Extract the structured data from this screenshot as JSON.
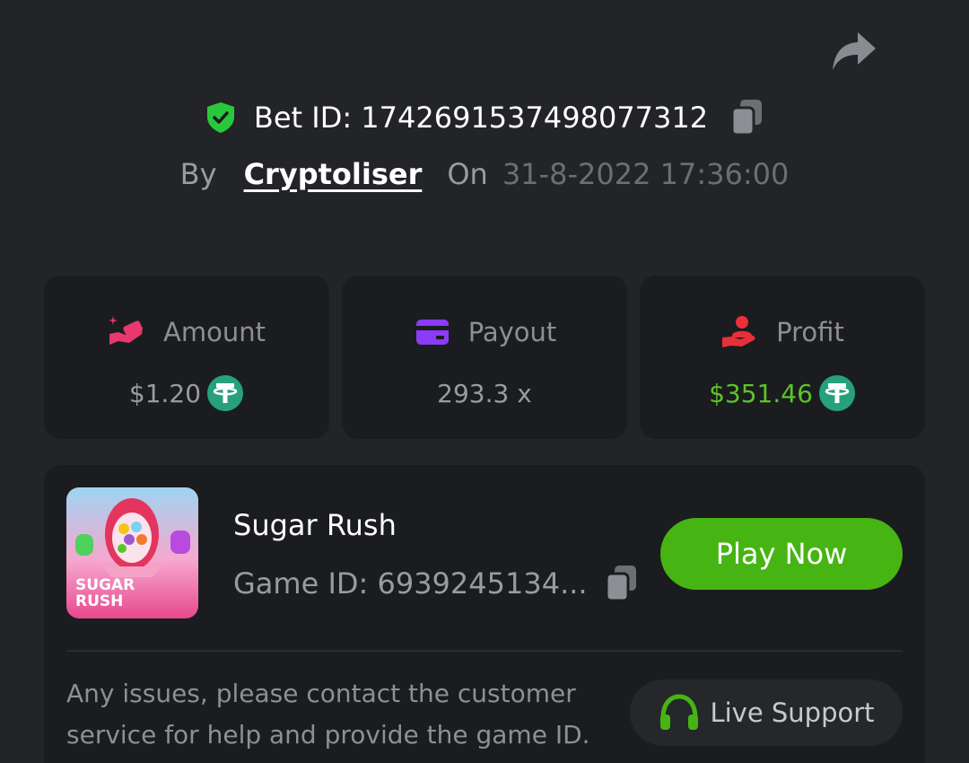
{
  "bet": {
    "label": "Bet ID: 1742691537498077312"
  },
  "meta": {
    "by_label": "By",
    "username": "Cryptoliser",
    "on_label": "On",
    "datetime": "31-8-2022 17:36:00"
  },
  "stats": [
    {
      "label": "Amount",
      "value": "$1.20",
      "icon": "hand-coin-icon",
      "currency_icon": "tether-icon"
    },
    {
      "label": "Payout",
      "value": "293.3 x",
      "icon": "card-icon"
    },
    {
      "label": "Profit",
      "value": "$351.46",
      "icon": "hand-profit-icon",
      "currency_icon": "tether-icon"
    }
  ],
  "game": {
    "title": "Sugar Rush",
    "game_id": "Game ID: 6939245134...",
    "thumb_text_1": "SUGAR",
    "thumb_text_2": "RUSH",
    "play_label": "Play Now"
  },
  "help": {
    "text": "Any issues, please contact the customer service for help and provide the game ID.",
    "support_label": "Live Support"
  },
  "colors": {
    "background": "#232427",
    "card": "#1b1c1f",
    "green": "#46b513",
    "profit_green": "#5cc42a",
    "tether": "#26a17b",
    "amount_icon": "#e8386e",
    "payout_icon": "#8b3cf6",
    "profit_icon": "#e8303a",
    "shield": "#29c83c"
  }
}
